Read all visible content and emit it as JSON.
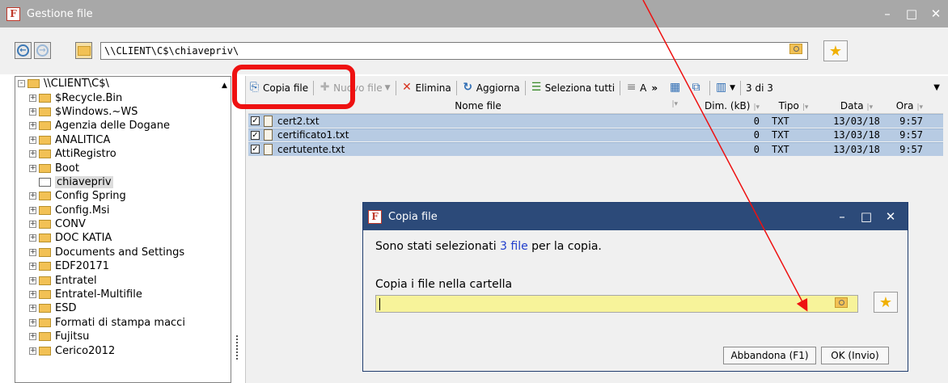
{
  "window": {
    "title": "Gestione file",
    "app_icon": "F",
    "minimize": "–",
    "maximize": "□",
    "close": "✕"
  },
  "address": {
    "back": "←",
    "forward": "→",
    "path": "\\\\CLIENT\\C$\\chiavepriv\\"
  },
  "tree": {
    "items": [
      {
        "label": "\\\\CLIENT\\C$\\",
        "expander": "-",
        "indent": 0
      },
      {
        "label": "$Recycle.Bin",
        "expander": "+",
        "indent": 1
      },
      {
        "label": "$Windows.~WS",
        "expander": "+",
        "indent": 1
      },
      {
        "label": "Agenzia delle Dogane",
        "expander": "+",
        "indent": 1
      },
      {
        "label": "ANALITICA",
        "expander": "+",
        "indent": 1
      },
      {
        "label": "AttiRegistro",
        "expander": "+",
        "indent": 1
      },
      {
        "label": "Boot",
        "expander": "+",
        "indent": 1
      },
      {
        "label": "chiavepriv",
        "expander": "",
        "indent": 1,
        "selected": true
      },
      {
        "label": "Config Spring",
        "expander": "+",
        "indent": 1
      },
      {
        "label": "Config.Msi",
        "expander": "+",
        "indent": 1
      },
      {
        "label": "CONV",
        "expander": "+",
        "indent": 1
      },
      {
        "label": "DOC KATIA",
        "expander": "+",
        "indent": 1
      },
      {
        "label": "Documents and Settings",
        "expander": "+",
        "indent": 1
      },
      {
        "label": "EDF20171",
        "expander": "+",
        "indent": 1
      },
      {
        "label": "Entratel",
        "expander": "+",
        "indent": 1
      },
      {
        "label": "Entratel-Multifile",
        "expander": "+",
        "indent": 1
      },
      {
        "label": "ESD",
        "expander": "+",
        "indent": 1
      },
      {
        "label": "Formati di stampa macci",
        "expander": "+",
        "indent": 1
      },
      {
        "label": "Fujitsu",
        "expander": "+",
        "indent": 1
      },
      {
        "label": "Cerico2012",
        "expander": "+",
        "indent": 1
      }
    ]
  },
  "toolbar": {
    "copy_label": "Copia file",
    "new_label": "Nuovo file",
    "delete_label": "Elimina",
    "refresh_label": "Aggiorna",
    "select_all_label": "Seleziona tutti",
    "sort_label": "A",
    "more": "»",
    "counter": "3 di 3"
  },
  "grid": {
    "headers": {
      "name": "Nome file",
      "dim": "Dim. (kB)",
      "tipo": "Tipo",
      "data": "Data",
      "ora": "Ora"
    },
    "rows": [
      {
        "name": "cert2.txt",
        "dim": "0",
        "tipo": "TXT",
        "data": "13/03/18",
        "ora": "9:57",
        "checked": "✓"
      },
      {
        "name": "certificato1.txt",
        "dim": "0",
        "tipo": "TXT",
        "data": "13/03/18",
        "ora": "9:57",
        "checked": "✓"
      },
      {
        "name": "certutente.txt",
        "dim": "0",
        "tipo": "TXT",
        "data": "13/03/18",
        "ora": "9:57",
        "checked": "✓"
      }
    ]
  },
  "dialog": {
    "title": "Copia file",
    "message_prefix": "Sono stati selezionati ",
    "message_count": "3 file",
    "message_suffix": " per la copia.",
    "folder_label": "Copia i file nella cartella",
    "folder_value": "",
    "cancel_label": "Abbandona (F1)",
    "ok_label": "OK (Invio)"
  },
  "colors": {
    "titlebar": "#a8a8a8",
    "dialog_titlebar": "#2c4a79",
    "selected_row": "#b7cbe3",
    "input_highlight": "#f7f39a",
    "annotation": "#ee1111"
  }
}
